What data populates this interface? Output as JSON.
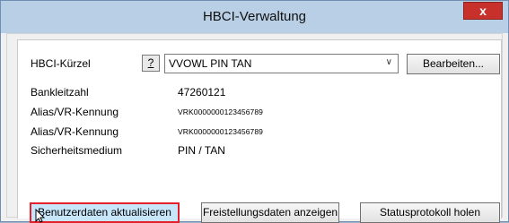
{
  "window": {
    "title": "HBCI-Verwaltung",
    "close_label": "x"
  },
  "form": {
    "kuerzel_label": "HBCI-Kürzel",
    "help_label": "?",
    "combo_value": "VVOWL PIN TAN",
    "edit_label": "Bearbeiten...",
    "fields": [
      {
        "label": "Bankleitzahl",
        "value": "47260121"
      },
      {
        "label": "Alias/VR-Kennung",
        "value": "VRK0000000123456789"
      },
      {
        "label": "Alias/VR-Kennung",
        "value": "VRK0000000123456789"
      },
      {
        "label": "Sicherheitsmedium",
        "value": "PIN / TAN"
      }
    ]
  },
  "actions": {
    "update_label": "Benutzerdaten aktualisieren",
    "bpd_label": "Freistellungsdaten anzeigen",
    "log_label": "Statusprotokoll holen"
  }
}
